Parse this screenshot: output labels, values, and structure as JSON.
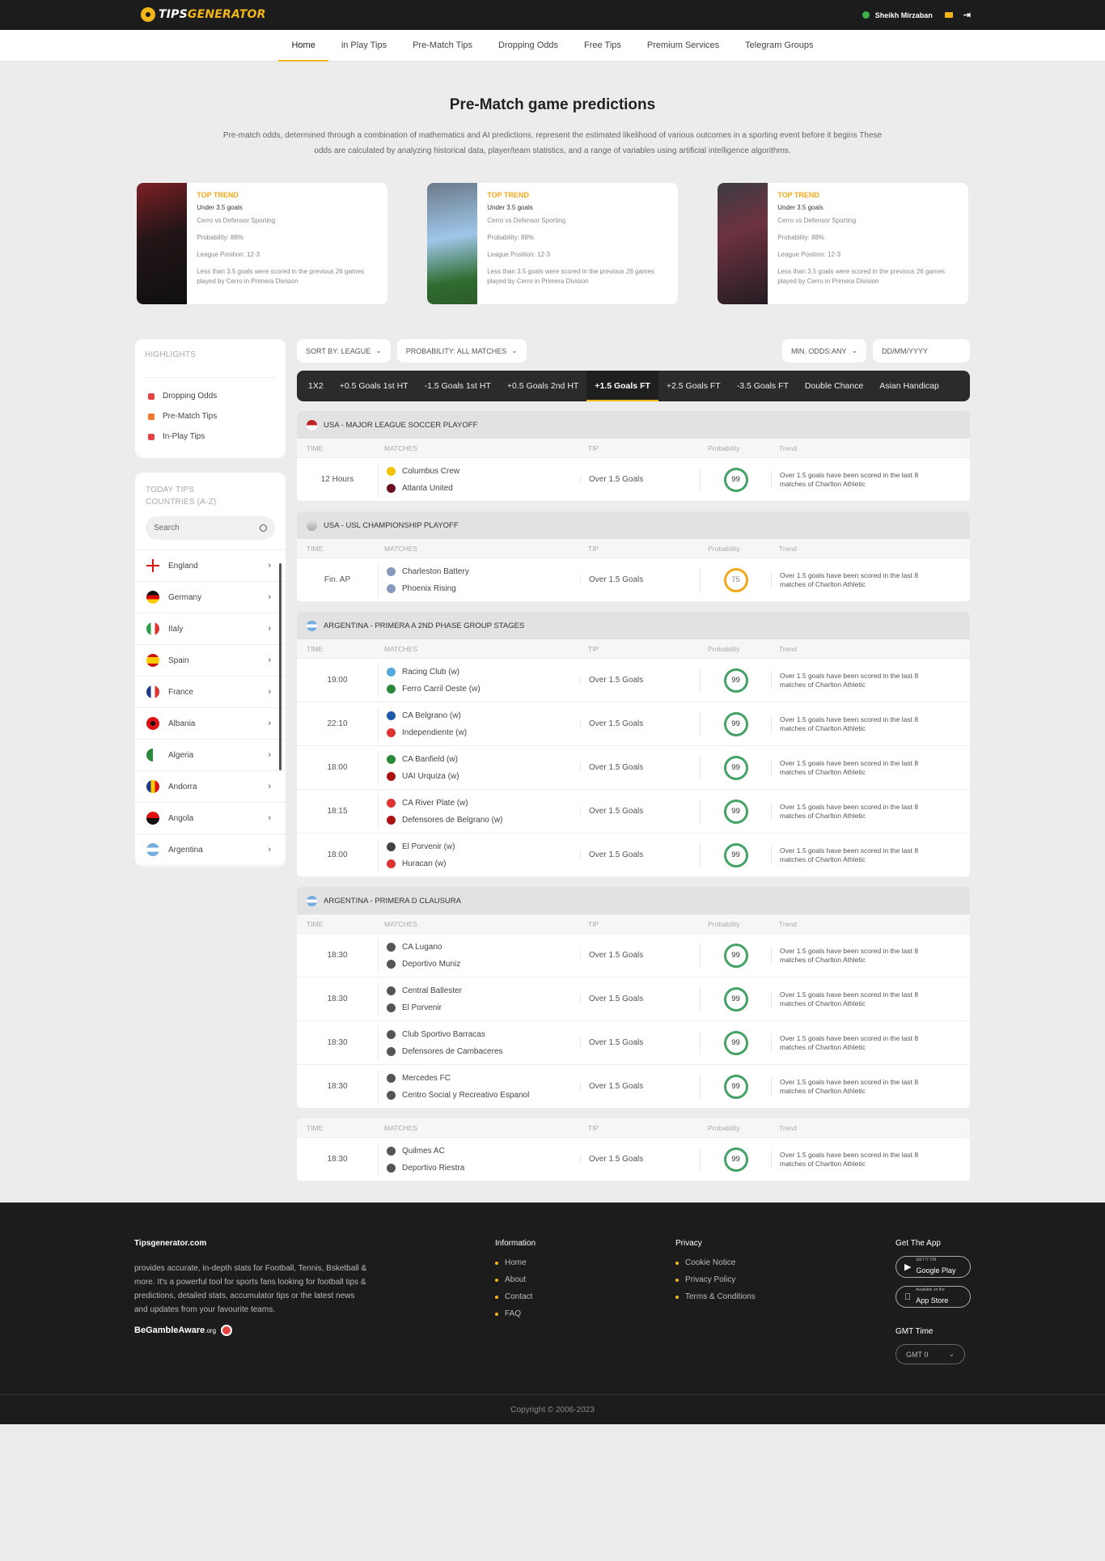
{
  "header": {
    "logo_prefix": "TIPS",
    "logo_suffix": "GENERATOR",
    "user_name": "Sheikh Mirzaban"
  },
  "nav": [
    "Home",
    "in Play Tips",
    "Pre-Match Tips",
    "Dropping Odds",
    "Free Tips",
    "Premium Services",
    "Telegram Groups"
  ],
  "hero": {
    "title": "Pre-Match game predictions",
    "description": "Pre-match odds, determined through a combination of mathematics and AI predictions, represent the estimated likelihood of various outcomes in a sporting event before it begins These odds are calculated by analyzing historical data, player/team statistics, and a range of variables using artificial intelligence algorithms."
  },
  "trend_cards": [
    {
      "tag": "TOP TREND",
      "under": "Under 3.5 goals",
      "match": "Cerro vs Defensor Sporting",
      "probability": "Probability: 88%",
      "league_position": "League Position: 12-3",
      "note": "Less than 3.5 goals were scored in the previous 26 games played by Cerro in Primera Division"
    },
    {
      "tag": "TOP TREND",
      "under": "Under 3.5 goals",
      "match": "Cerro vs Defensor Sporting",
      "probability": "Probability: 88%",
      "league_position": "League Position: 12-3",
      "note": "Less than 3.5 goals were scored in the previous 26 games played by Cerro in Primera Division"
    },
    {
      "tag": "TOP TREND",
      "under": "Under 3.5 goals",
      "match": "Cerro vs Defensor Sporting",
      "probability": "Probability: 88%",
      "league_position": "League Position: 12-3",
      "note": "Less than 3.5 goals were scored in the previous 26 games played by Cerro in Primera Division"
    }
  ],
  "highlights": {
    "title": "HIGHLIGHTS",
    "items": [
      "Dropping Odds",
      "Pre-Match Tips",
      "In-Play Tips"
    ]
  },
  "countries_box": {
    "title_line1": "TODAY TIPS",
    "title_line2": "COUNTRIES (A-Z)",
    "search_placeholder": "Search",
    "countries": [
      "England",
      "Germany",
      "Italy",
      "Spain",
      "France",
      "Albania",
      "Algeria",
      "Andorra",
      "Angola",
      "Argentina"
    ]
  },
  "filters": {
    "sort": "SORT BY: LEAGUE",
    "probability": "PROBABILITY: ALL MATCHES",
    "min_odds": "MIN. ODDS:ANY",
    "date_placeholder": "DD/MM/YYYY"
  },
  "market_tabs": [
    "1X2",
    "+0.5 Goals 1st HT",
    "-1.5 Goals 1st HT",
    "+0.5 Goals 2nd HT",
    "+1.5 Goals FT",
    "+2.5 Goals FT",
    "-3.5 Goals FT",
    "Double Chance",
    "Asian Handicap"
  ],
  "columns": {
    "time": "TIME",
    "matches": "MATCHES",
    "tip": "TIP",
    "probability": "Probability",
    "trend": "Trend"
  },
  "leagues": [
    {
      "name": "USA - MAJOR LEAGUE SOCCER PLAYOFF",
      "matches": [
        {
          "time": "12 Hours",
          "home": "Columbus Crew",
          "away": "Atlanta United",
          "tip": "Over 1.5 Goals",
          "prob": "99",
          "trend": "Over 1.5 goals have been scored in the last 8 matches of Charlton Athletic"
        }
      ]
    },
    {
      "name": "USA - USL CHAMPIONSHIP PLAYOFF",
      "matches": [
        {
          "time": "Fin. AP",
          "home": "Charleston Battery",
          "away": "Phoenix Rising",
          "tip": "Over 1.5 Goals",
          "prob": "75",
          "trend": "Over 1.5 goals have been scored in the last 8 matches of Charlton Athletic"
        }
      ]
    },
    {
      "name": "ARGENTINA - PRIMERA A 2ND PHASE GROUP STAGES",
      "matches": [
        {
          "time": "19:00",
          "home": "Racing Club (w)",
          "away": "Ferro Carril Oeste (w)",
          "tip": "Over 1.5 Goals",
          "prob": "99",
          "trend": "Over 1.5 goals have been scored in the last 8 matches of Charlton Athletic"
        },
        {
          "time": "22:10",
          "home": "CA Belgrano (w)",
          "away": "Independiente (w)",
          "tip": "Over 1.5 Goals",
          "prob": "99",
          "trend": "Over 1.5 goals have been scored in the last 8 matches of Charlton Athletic"
        },
        {
          "time": "18:00",
          "home": "CA Banfield (w)",
          "away": "UAI Urquiza (w)",
          "tip": "Over 1.5 Goals",
          "prob": "99",
          "trend": "Over 1.5 goals have been scored in the last 8 matches of Charlton Athletic"
        },
        {
          "time": "18:15",
          "home": "CA River Plate (w)",
          "away": "Defensores de Belgrano (w)",
          "tip": "Over 1.5 Goals",
          "prob": "99",
          "trend": "Over 1.5 goals have been scored in the last 8 matches of Charlton Athletic"
        },
        {
          "time": "18:00",
          "home": "El Porvenir (w)",
          "away": "Huracan (w)",
          "tip": "Over 1.5 Goals",
          "prob": "99",
          "trend": "Over 1.5 goals have been scored in the last 8 matches of Charlton Athletic"
        }
      ]
    },
    {
      "name": "ARGENTINA - PRIMERA D CLAUSURA",
      "matches": [
        {
          "time": "18:30",
          "home": "CA Lugano",
          "away": "Deportivo Muniz",
          "tip": "Over 1.5 Goals",
          "prob": "99",
          "trend": "Over 1.5 goals have been scored in the last 8 matches of Charlton Athletic"
        },
        {
          "time": "18:30",
          "home": "Central Ballester",
          "away": "El Porvenir",
          "tip": "Over 1.5 Goals",
          "prob": "99",
          "trend": "Over 1.5 goals have been scored in the last 8 matches of Charlton Athletic"
        },
        {
          "time": "18:30",
          "home": "Club Sportivo Barracas",
          "away": "Defensores de Cambaceres",
          "tip": "Over 1.5 Goals",
          "prob": "99",
          "trend": "Over 1.5 goals have been scored in the last 8 matches of Charlton Athletic"
        },
        {
          "time": "18:30",
          "home": "Mercedes FC",
          "away": "Centro Social y Recreativo Espanol",
          "tip": "Over 1.5 Goals",
          "prob": "99",
          "trend": "Over 1.5 goals have been scored in the last 8 matches of Charlton Athletic"
        }
      ]
    },
    {
      "name": "",
      "matches": [
        {
          "time": "18:30",
          "home": "Quilmes AC",
          "away": "Deportivo Riestra",
          "tip": "Over 1.5 Goals",
          "prob": "99",
          "trend": "Over 1.5 goals have been scored in the last 8 matches of Charlton Athletic"
        }
      ]
    }
  ],
  "footer": {
    "brand": "Tipsgenerator.com",
    "about": "provides accurate, in-depth stats for Football, Tennis, Bsketball & more. It's a powerful tool for sports fans looking for football tips & predictions, detailed stats, accumulator tips or the latest news and updates from your favourite teams.",
    "gamble_prefix": "Be",
    "gamble_main": "GambleAware",
    "gamble_suffix": ".org",
    "info_title": "Information",
    "info_links": [
      "Home",
      "About",
      "Contact",
      "FAQ"
    ],
    "privacy_title": "Privacy",
    "privacy_links": [
      "Cookie Notice",
      "Privacy Policy",
      "Terms & Conditions"
    ],
    "app_title": "Get The App",
    "google_small": "GET IT ON",
    "google_label": "Google Play",
    "apple_small": "Available on the",
    "apple_label": "App Store",
    "gmt_title": "GMT Time",
    "gmt_value": "GMT 0",
    "copyright": "Copyright © 2006-2023"
  },
  "colors": {
    "accent": "#f2b61a",
    "dark": "#1c1c1c",
    "prob_green": "#45a266",
    "prob_orange": "#f2a81a"
  }
}
